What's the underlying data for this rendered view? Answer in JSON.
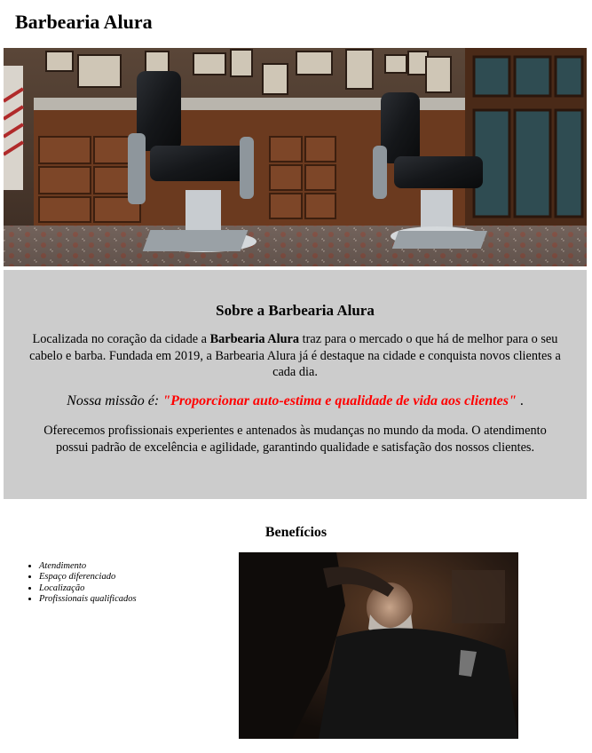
{
  "header": {
    "title": "Barbearia Alura"
  },
  "hero": {
    "image": "barbershop-interior-photo"
  },
  "about": {
    "title": "Sobre a Barbearia Alura",
    "intro_before": "Localizada no coração da cidade a ",
    "intro_brand": "Barbearia Alura",
    "intro_after": " traz para o mercado o que há de melhor para o seu cabelo e barba. Fundada em 2019, a Barbearia Alura já é destaque na cidade e conquista novos clientes a cada dia.",
    "mission_lead": "Nossa missão é: ",
    "mission_quote": "\"Proporcionar auto-estima e qualidade de vida aos clientes\"",
    "mission_end": " .",
    "mission_color": "#ff0000",
    "services": "Oferecemos profissionais experientes e antenados às mudanças no mundo da moda. O atendimento possui padrão de excelência e agilidade, garantindo qualidade e satisfação dos nossos clientes.",
    "background": "#cccccc"
  },
  "benefits": {
    "title": "Benefícios",
    "items": [
      "Atendimento",
      "Espaço diferenciado",
      "Localização",
      "Profissionais qualificados"
    ],
    "image": "barber-trimming-beard-photo"
  }
}
